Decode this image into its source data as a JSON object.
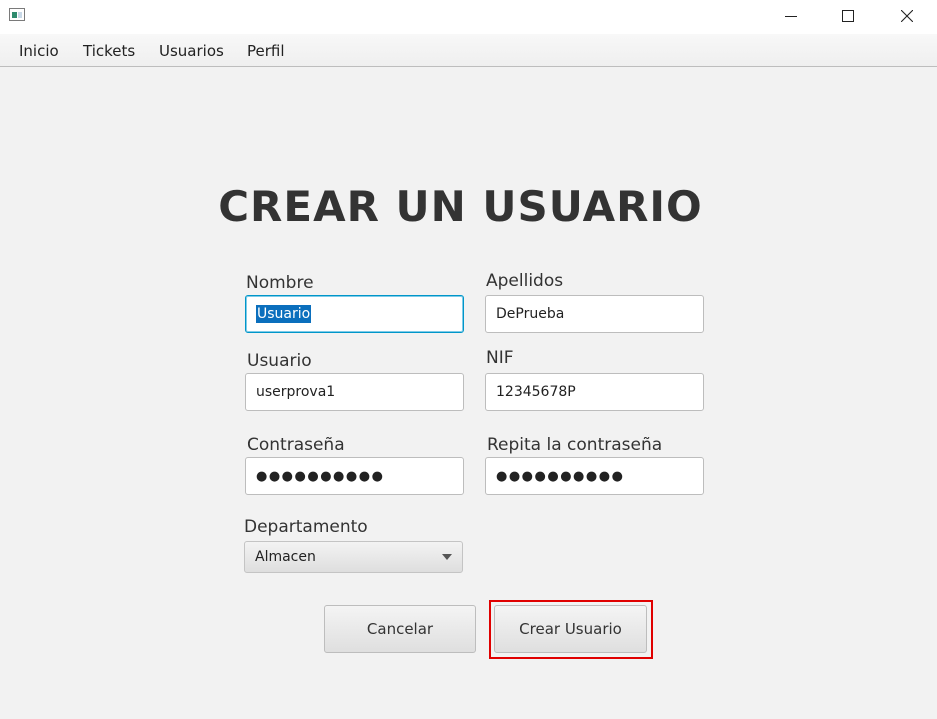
{
  "window": {
    "icon": "app-window-icon",
    "controls": [
      "minimize-icon",
      "maximize-icon",
      "close-icon"
    ]
  },
  "menu": {
    "items": [
      {
        "label": "Inicio"
      },
      {
        "label": "Tickets"
      },
      {
        "label": "Usuarios"
      },
      {
        "label": "Perfil"
      }
    ]
  },
  "form": {
    "title": "CREAR UN USUARIO",
    "nombre": {
      "label": "Nombre",
      "value": "Usuario"
    },
    "apellidos": {
      "label": "Apellidos",
      "value": "DePrueba"
    },
    "usuario": {
      "label": "Usuario",
      "value": "userprova1"
    },
    "nif": {
      "label": "NIF",
      "value": "12345678P"
    },
    "contrasena": {
      "label": "Contraseña",
      "value": "●●●●●●●●●●"
    },
    "repita": {
      "label": "Repita la contraseña",
      "value": "●●●●●●●●●●"
    },
    "departamento": {
      "label": "Departamento",
      "selected": "Almacen"
    },
    "cancel_label": "Cancelar",
    "create_label": "Crear Usuario"
  },
  "colors": {
    "accent_focus": "#0096c9",
    "selection": "#0b6fbd",
    "highlight": "#e00000"
  }
}
